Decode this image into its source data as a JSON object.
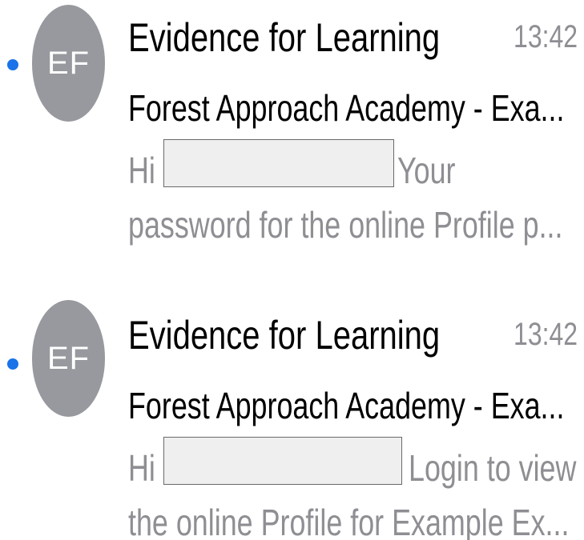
{
  "messages": [
    {
      "unread": true,
      "avatar_initials": "EF",
      "sender": "Evidence for Learning",
      "time": "13:42",
      "subject": "Forest Approach Academy - Exa...",
      "preview_greeting": "Hi",
      "preview_after_redaction": "Your",
      "preview_line2": "password for the online Profile p..."
    },
    {
      "unread": true,
      "avatar_initials": "EF",
      "sender": "Evidence for Learning",
      "time": "13:42",
      "subject": "Forest Approach Academy - Exa...",
      "preview_greeting": "Hi",
      "preview_after_redaction": "Login to view",
      "preview_line2": "the online Profile for Example Ex..."
    }
  ],
  "colors": {
    "unread_dot": "#1a73e8",
    "avatar_bg": "#97999e",
    "secondary_text": "#8e8e93",
    "redaction_fill": "#efefef"
  }
}
